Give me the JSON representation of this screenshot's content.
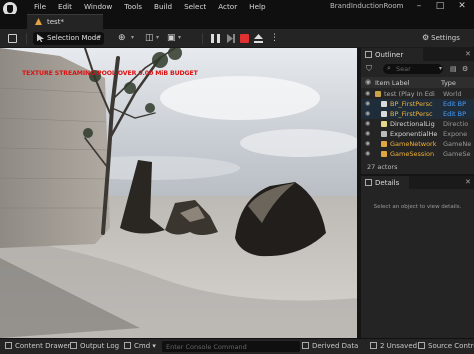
{
  "menubar": {
    "items": [
      "File",
      "Edit",
      "Window",
      "Tools",
      "Build",
      "Select",
      "Actor",
      "Help"
    ],
    "window_title": "BrandInductionRoom",
    "minimize": "–",
    "maximize": "□",
    "close": "✕"
  },
  "tabs": [
    {
      "label": "test*"
    }
  ],
  "toolbar": {
    "mode_label": "Selection Mode",
    "settings_label": "Settings"
  },
  "viewport": {
    "debug_text": "TEXTURE STREAMING POOL OVER 0.00 MiB BUDGET"
  },
  "outliner": {
    "title": "Outliner",
    "search_placeholder": "Sear",
    "columns": {
      "label": "Item Label",
      "type": "Type"
    },
    "rows": [
      {
        "name": "test (Play In Edi",
        "type": "World",
        "name_color": "#a8a8a8",
        "icon_color": "#c9a24a",
        "type_link": false
      },
      {
        "name": "BP_FirstPersc",
        "type": "Edit BP",
        "name_color": "#f0b23a",
        "icon_color": "#d9d9d9",
        "type_link": true
      },
      {
        "name": "BP_FirstPersc",
        "type": "Edit BP",
        "name_color": "#f0b23a",
        "icon_color": "#d9d9d9",
        "type_link": true
      },
      {
        "name": "DirectionalLig",
        "type": "Directio",
        "name_color": "#d8d8d8",
        "icon_color": "#e6d68a",
        "type_link": false
      },
      {
        "name": "ExponentialHe",
        "type": "Expone",
        "name_color": "#d8d8d8",
        "icon_color": "#bbbbbb",
        "type_link": false
      },
      {
        "name": "GameNetwork",
        "type": "GameNe",
        "name_color": "#f0b23a",
        "icon_color": "#e0a640",
        "type_link": false
      },
      {
        "name": "GameSession",
        "type": "GameSe",
        "name_color": "#f0b23a",
        "icon_color": "#e0a640",
        "type_link": false
      }
    ],
    "actor_count": "27 actors"
  },
  "details": {
    "title": "Details",
    "hint": "Select an object to view details."
  },
  "statusbar": {
    "content_drawer": "Content Drawer",
    "output_log": "Output Log",
    "cmd": "Cmd",
    "console_placeholder": "Enter Console Command",
    "derived_data": "Derived Data",
    "unsaved": "2 Unsaved",
    "source_control": "Source Control"
  },
  "colors": {
    "accent": "#4a9eff",
    "stop": "#e03030",
    "debug_text": "#dd1111",
    "actor_orange": "#f0b23a"
  }
}
